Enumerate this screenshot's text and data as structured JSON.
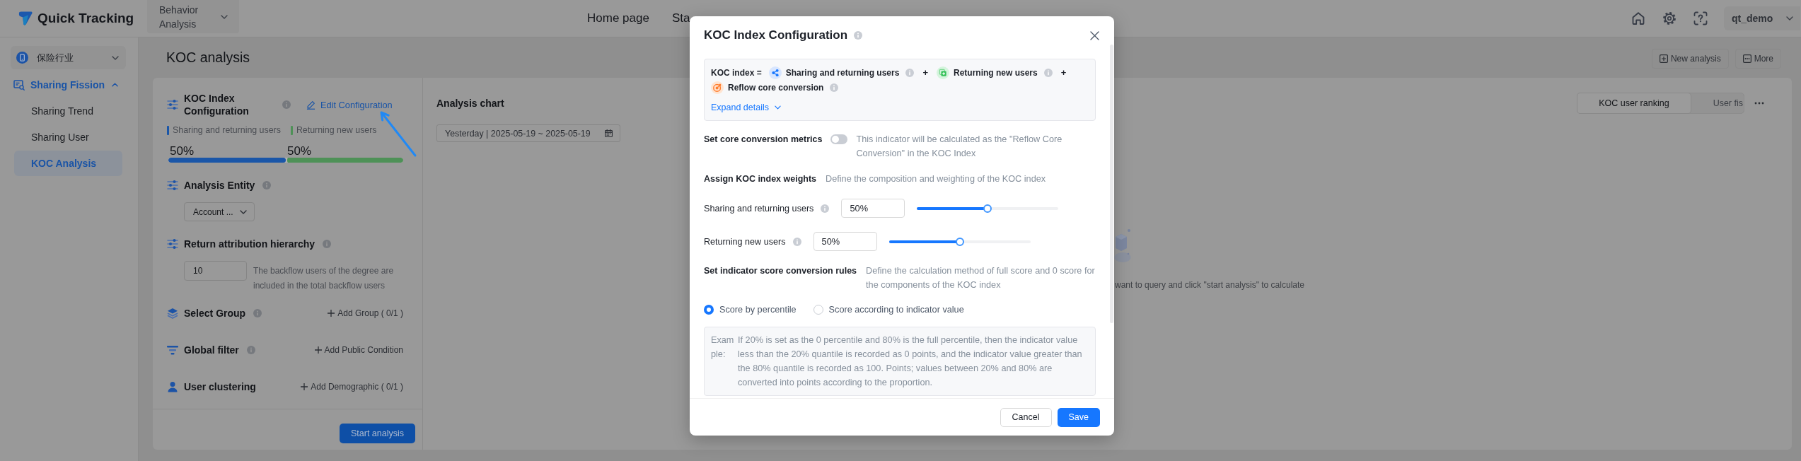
{
  "header": {
    "logo_text": "Quick Tracking",
    "product_switcher": "Behavior Analysis",
    "nav": [
      {
        "label": "Home page",
        "selected": false
      },
      {
        "label": "Sta",
        "selected": false
      }
    ],
    "user": "qt_demo"
  },
  "sidebar": {
    "workspace": "保险行业",
    "groups": [
      {
        "label": "Sharing Fission",
        "expanded": true,
        "children": [
          {
            "label": "Sharing Trend",
            "selected": false
          },
          {
            "label": "Sharing User",
            "selected": false
          },
          {
            "label": "KOC Analysis",
            "selected": true
          }
        ]
      }
    ]
  },
  "page": {
    "title": "KOC analysis",
    "actions": [
      {
        "label": "New analysis",
        "kind": "new"
      },
      {
        "label": "More",
        "kind": "more"
      }
    ]
  },
  "config_panel": {
    "koc_index": {
      "title": "KOC Index Configuration",
      "edit_link": "Edit Configuration",
      "components": [
        {
          "label": "Sharing and returning users",
          "share": "50%",
          "level": 0.5,
          "color": "#1a56a8"
        },
        {
          "label": "Returning new users",
          "share": "50%",
          "level": 0.5,
          "color": "#4e9157"
        }
      ]
    },
    "analysis_entity": {
      "title": "Analysis Entity",
      "value": "Account ..."
    },
    "return_attribution": {
      "title": "Return attribution hierarchy",
      "value": "10",
      "hint": "The backflow users of the degree are included in the total backflow users"
    },
    "sections": [
      {
        "title": "Select Group",
        "info": true,
        "action": "Add Group ( 0/1 )",
        "kind": "group"
      },
      {
        "title": "Global filter",
        "info": true,
        "action": "Add Public Condition",
        "kind": "filter"
      },
      {
        "title": "User clustering",
        "info": false,
        "action": "Add Demographic ( 0/1 )",
        "kind": "user"
      }
    ],
    "start_button": "Start analysis"
  },
  "chart_panel": {
    "title": "Analysis chart",
    "date_range": "Yesterday | 2025-05-19 ~ 2025-05-19",
    "views": [
      {
        "label": "KOC user ranking",
        "selected": true
      },
      {
        "label": "User fis",
        "selected": false
      }
    ],
    "empty_text": "want to query and click \"start analysis\" to calculate"
  },
  "modal": {
    "title": "KOC Index Configuration",
    "formula": {
      "lead": "KOC index =",
      "terms": [
        {
          "label": "Sharing and returning users",
          "kind": "share",
          "operator": "+"
        },
        {
          "label": "Returning new users",
          "kind": "new_user",
          "operator": "+"
        },
        {
          "label": "Reflow core conversion",
          "kind": "conversion"
        }
      ],
      "expand_link": "Expand details"
    },
    "core_conversion": {
      "label": "Set core conversion metrics",
      "on": false,
      "description": "This indicator will be calculated as the \"Reflow Core Conversion\" in the KOC Index"
    },
    "weights": {
      "label": "Assign KOC index weights",
      "description": "Define the composition and weighting of the KOC index",
      "items": [
        {
          "label": "Sharing and returning users",
          "value": "50%",
          "level": 0.5
        },
        {
          "label": "Returning new users",
          "value": "50%",
          "level": 0.5
        }
      ]
    },
    "score_rules": {
      "label": "Set indicator score conversion rules",
      "description": "Define the calculation method of full score and 0 score for the components of the KOC index",
      "options": [
        {
          "label": "Score by percentile",
          "selected": true
        },
        {
          "label": "Score according to indicator value",
          "selected": false
        }
      ],
      "example_label": "Example:",
      "example_text": "If 20% is set as the 0 percentile and 80% is the full percentile, then the indicator value less than the 20% quantile is recorded as 0 points, and the indicator value greater than the 80% quantile is recorded as 100. Points; values between 20% and 80% are converted into points according to the proportion."
    },
    "buttons": [
      {
        "label": "Cancel",
        "kind": "secondary"
      },
      {
        "label": "Save",
        "kind": "primary"
      }
    ]
  }
}
